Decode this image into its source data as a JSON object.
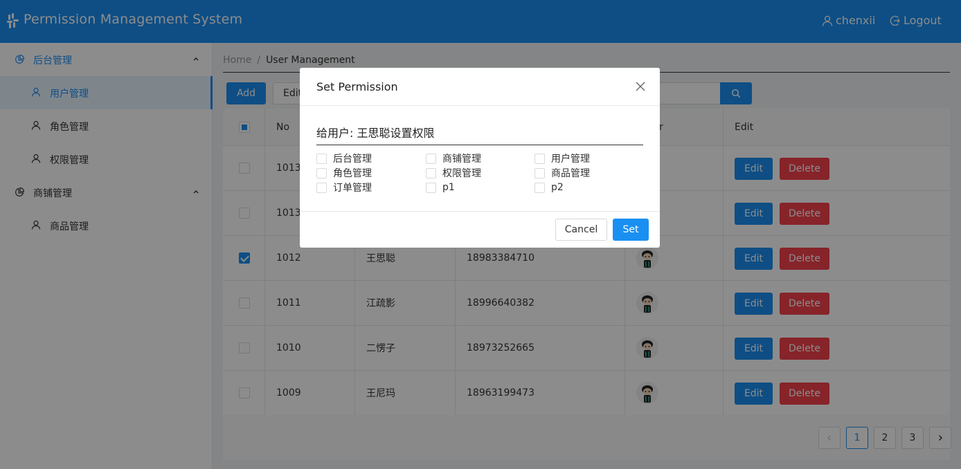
{
  "header": {
    "app_title": "Permission Management System",
    "username": "chenxii",
    "logout_label": "Logout"
  },
  "sidebar": {
    "groups": [
      {
        "label": "后台管理",
        "expanded": true,
        "items": [
          {
            "label": "用户管理",
            "active": true
          },
          {
            "label": "角色管理",
            "active": false
          },
          {
            "label": "权限管理",
            "active": false
          }
        ]
      },
      {
        "label": "商铺管理",
        "expanded": true,
        "items": [
          {
            "label": "商品管理",
            "active": false
          }
        ]
      }
    ]
  },
  "breadcrumb": {
    "home": "Home",
    "separator": "/",
    "current": "User Management"
  },
  "toolbar": {
    "add_label": "Add",
    "edit_label": "Edit"
  },
  "table": {
    "columns": [
      "No",
      "r",
      "Edit"
    ],
    "rows": [
      {
        "no": "1013",
        "name": "",
        "phone": "",
        "checked": false
      },
      {
        "no": "1013",
        "name": "",
        "phone": "",
        "checked": false
      },
      {
        "no": "1012",
        "name": "王思聪",
        "phone": "18983384710",
        "checked": true
      },
      {
        "no": "1011",
        "name": "江疏影",
        "phone": "18996640382",
        "checked": false
      },
      {
        "no": "1010",
        "name": "二愣子",
        "phone": "18973252665",
        "checked": false
      },
      {
        "no": "1009",
        "name": "王尼玛",
        "phone": "18963199473",
        "checked": false
      }
    ],
    "edit_label": "Edit",
    "delete_label": "Delete"
  },
  "pagination": {
    "pages": [
      "1",
      "2",
      "3"
    ],
    "current": "1",
    "prev_icon": "chevron-left-icon",
    "next_icon": "chevron-right-icon"
  },
  "modal": {
    "title": "Set Permission",
    "subtitle": "给用户: 王思聪设置权限",
    "permissions": [
      {
        "label": "后台管理",
        "checked": false
      },
      {
        "label": "商铺管理",
        "checked": false
      },
      {
        "label": "用户管理",
        "checked": false
      },
      {
        "label": "角色管理",
        "checked": false
      },
      {
        "label": "权限管理",
        "checked": false
      },
      {
        "label": "商品管理",
        "checked": false
      },
      {
        "label": "订单管理",
        "checked": false
      },
      {
        "label": "p1",
        "checked": false
      },
      {
        "label": "p2",
        "checked": false
      }
    ],
    "cancel_label": "Cancel",
    "set_label": "Set"
  },
  "colors": {
    "primary": "#1a8ff2",
    "danger": "#f5424d",
    "header_bg": "#1a8ff2"
  }
}
